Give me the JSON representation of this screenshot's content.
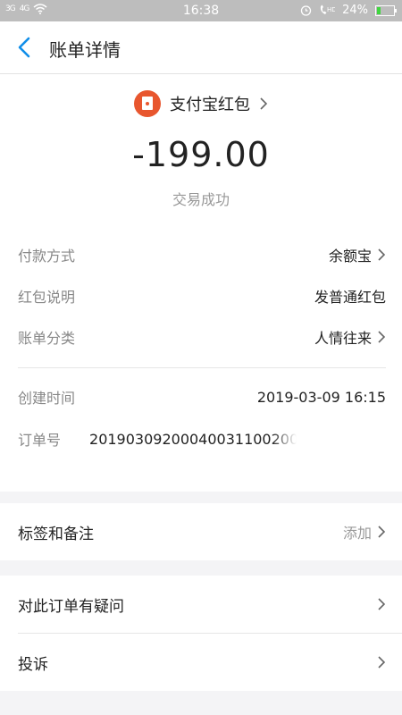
{
  "status_bar": {
    "time": "16:38",
    "battery": "24%",
    "battery_level": 0.24,
    "signal1": "3G",
    "signal2": "4G"
  },
  "nav": {
    "title": "账单详情"
  },
  "summary": {
    "merchant": "支付宝红包",
    "amount": "-199.00",
    "status": "交易成功"
  },
  "details": [
    {
      "key": "付款方式",
      "value": "余额宝"
    },
    {
      "key": "红包说明",
      "value": "发普通红包"
    },
    {
      "key": "账单分类",
      "value": "人情往来"
    },
    {
      "key": "创建时间",
      "value": "2019-03-09 16:15"
    },
    {
      "key": "订单号",
      "value": "201903092000400311002000"
    }
  ],
  "tags": {
    "label": "标签和备注",
    "action": "添加"
  },
  "menu": [
    {
      "label": "对此订单有疑问"
    },
    {
      "label": "投诉"
    }
  ],
  "colors": {
    "accent": "#108ee9",
    "merchant_icon": "#e8562e"
  }
}
